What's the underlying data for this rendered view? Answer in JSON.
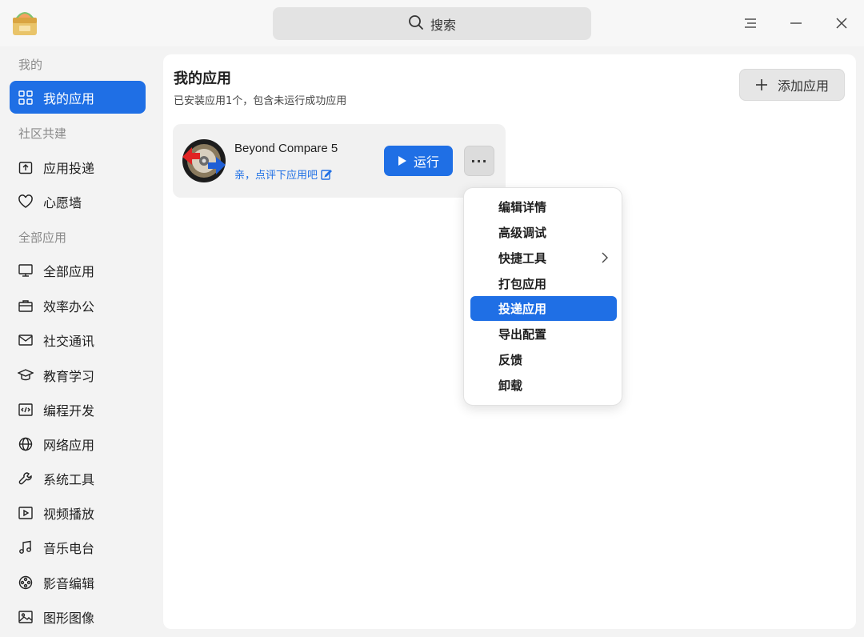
{
  "window": {
    "search_placeholder": "搜索"
  },
  "sidebar": {
    "sections": [
      {
        "title": "我的"
      },
      {
        "title": "社区共建"
      },
      {
        "title": "全部应用"
      }
    ],
    "items": [
      {
        "label": "我的应用",
        "icon": "grid-icon",
        "active": true
      },
      {
        "label": "应用投递",
        "icon": "upload-box-icon"
      },
      {
        "label": "心愿墙",
        "icon": "heart-icon"
      },
      {
        "label": "全部应用",
        "icon": "monitor-icon"
      },
      {
        "label": "效率办公",
        "icon": "briefcase-icon"
      },
      {
        "label": "社交通讯",
        "icon": "mail-icon"
      },
      {
        "label": "教育学习",
        "icon": "graduation-cap-icon"
      },
      {
        "label": "编程开发",
        "icon": "code-icon"
      },
      {
        "label": "网络应用",
        "icon": "globe-icon"
      },
      {
        "label": "系统工具",
        "icon": "wrench-icon"
      },
      {
        "label": "视频播放",
        "icon": "video-play-icon"
      },
      {
        "label": "音乐电台",
        "icon": "music-note-icon"
      },
      {
        "label": "影音编辑",
        "icon": "film-reel-icon"
      },
      {
        "label": "图形图像",
        "icon": "image-icon"
      }
    ]
  },
  "main": {
    "title": "我的应用",
    "subtitle": "已安装应用1个，包含未运行成功应用",
    "add_button": "添加应用",
    "apps": [
      {
        "name": "Beyond Compare 5",
        "rate_link": "亲，点评下应用吧",
        "run_label": "运行",
        "more_label": "···"
      }
    ]
  },
  "context_menu": {
    "items": [
      {
        "label": "编辑详情"
      },
      {
        "label": "高级调试"
      },
      {
        "label": "快捷工具",
        "has_submenu": true
      },
      {
        "label": "打包应用"
      },
      {
        "label": "投递应用",
        "highlighted": true
      },
      {
        "label": "导出配置"
      },
      {
        "label": "反馈"
      },
      {
        "label": "卸载"
      }
    ]
  },
  "colors": {
    "accent": "#1f6fe5",
    "sidebar_bg": "#f3f3f3",
    "content_bg": "#ffffff"
  }
}
